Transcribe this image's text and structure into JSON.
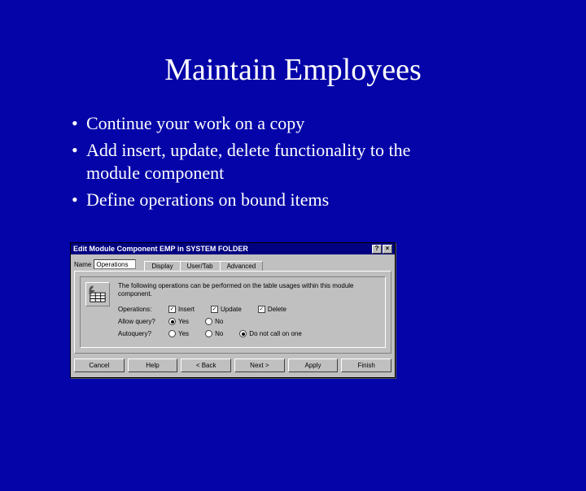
{
  "title": "Maintain Employees",
  "bullets": [
    "Continue your work on a copy",
    "Add insert, update, delete functionality to the module component",
    "Define operations on bound items"
  ],
  "dialog": {
    "title": "Edit Module Component EMP in SYSTEM FOLDER",
    "help_btn": "?",
    "close_btn": "×",
    "name_label": "Name",
    "name_value": "Operations",
    "tabs": [
      "Display",
      "User/Tab",
      "Advanced"
    ],
    "desc": "The following operations can be performed on the table usages within this module component.",
    "rows": {
      "ops": {
        "label": "Operations:",
        "opts": [
          {
            "label": "Insert",
            "checked": true
          },
          {
            "label": "Update",
            "checked": true
          },
          {
            "label": "Delete",
            "checked": true
          }
        ]
      },
      "allow": {
        "label": "Allow query?",
        "opts": [
          {
            "label": "Yes",
            "checked": true
          },
          {
            "label": "No",
            "checked": false
          }
        ]
      },
      "auto": {
        "label": "Autoquery?",
        "opts": [
          {
            "label": "Yes",
            "checked": false
          },
          {
            "label": "No",
            "checked": false
          },
          {
            "label": "Do not call on one",
            "checked": true
          }
        ]
      }
    },
    "buttons": [
      "Cancel",
      "Help",
      "< Back",
      "Next >",
      "Apply",
      "Finish"
    ]
  }
}
